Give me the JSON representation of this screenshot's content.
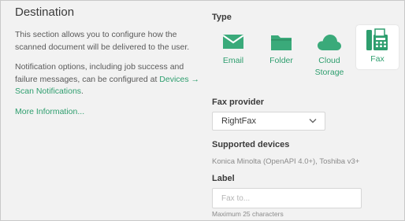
{
  "section": {
    "title": "Destination",
    "description": "This section allows you to configure how the scanned document will be delivered to the user.",
    "notification_text": "Notification options, including job success and failure messages, can be configured at ",
    "notification_link": "Devices → Scan Notifications",
    "notification_end": ".",
    "more_info": "More Information..."
  },
  "type": {
    "label": "Type",
    "options": [
      {
        "label": "Email",
        "icon": "envelope-icon"
      },
      {
        "label": "Folder",
        "icon": "folder-icon"
      },
      {
        "label": "Cloud Storage",
        "icon": "cloud-icon"
      },
      {
        "label": "Fax",
        "icon": "fax-icon"
      }
    ],
    "selected": "Fax"
  },
  "fax_provider": {
    "label": "Fax provider",
    "value": "RightFax"
  },
  "supported_devices": {
    "label": "Supported devices",
    "value": "Konica Minolta (OpenAPI 4.0+), Toshiba v3+"
  },
  "label_field": {
    "label": "Label",
    "placeholder": "Fax to...",
    "hint": "Maximum 25 characters"
  },
  "colors": {
    "accent": "#2e9e6e",
    "background": "#f2f2f2",
    "text": "#3a3a3a"
  }
}
